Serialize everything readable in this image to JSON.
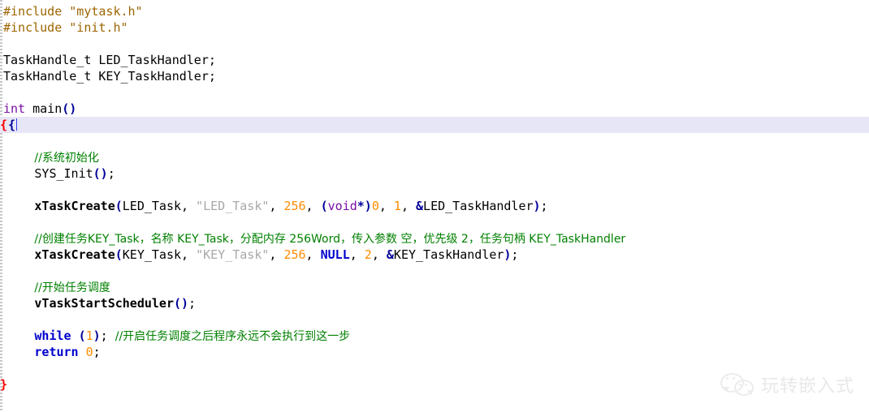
{
  "window": {
    "kind": "source-code-editor",
    "language": "C",
    "background": "#ffffff"
  },
  "colors": {
    "preprocessor": "#9c6500",
    "string": "#a8a8a8",
    "keyword_violet": "#7a0ea6",
    "keyword_bold_blue": "#0000cd",
    "punctuation": "#00009a",
    "number": "#ff8c00",
    "comment": "#008000",
    "plain": "#000000",
    "brace_marker": "#ff0000",
    "current_line_bg": "#e6e6f7",
    "caret": "#3a3af0"
  },
  "code": {
    "lines": [
      {
        "n": 1,
        "indent": 0,
        "tokens": [
          {
            "t": "#include ",
            "c": "pre"
          },
          {
            "t": "\"mytask.h\"",
            "c": "pre"
          }
        ]
      },
      {
        "n": 2,
        "indent": 0,
        "tokens": [
          {
            "t": "#include ",
            "c": "pre"
          },
          {
            "t": "\"init.h\"",
            "c": "pre"
          }
        ]
      },
      {
        "n": 3,
        "indent": 0,
        "tokens": []
      },
      {
        "n": 4,
        "indent": 0,
        "tokens": [
          {
            "t": "TaskHandle_t LED_TaskHandler;",
            "c": "plain"
          }
        ]
      },
      {
        "n": 5,
        "indent": 0,
        "tokens": [
          {
            "t": "TaskHandle_t KEY_TaskHandler;",
            "c": "plain"
          }
        ]
      },
      {
        "n": 6,
        "indent": 0,
        "tokens": []
      },
      {
        "n": 7,
        "indent": 0,
        "tokens": [
          {
            "t": "int",
            "c": "kw"
          },
          {
            "t": " main",
            "c": "plain"
          },
          {
            "t": "()",
            "c": "punct"
          }
        ]
      },
      {
        "n": 8,
        "indent": 0,
        "current": true,
        "marker": "{",
        "caret": true,
        "tokens": [
          {
            "t": "{",
            "c": "punct"
          }
        ]
      },
      {
        "n": 9,
        "indent": 0,
        "tokens": []
      },
      {
        "n": 10,
        "indent": 4,
        "tokens": [
          {
            "t": "//系统初始化",
            "c": "cmt"
          }
        ]
      },
      {
        "n": 11,
        "indent": 4,
        "tokens": [
          {
            "t": "SYS_Init",
            "c": "plain"
          },
          {
            "t": "()",
            "c": "punct"
          },
          {
            "t": ";",
            "c": "plain"
          }
        ]
      },
      {
        "n": 12,
        "indent": 0,
        "tokens": []
      },
      {
        "n": 13,
        "indent": 4,
        "tokens": [
          {
            "t": "xTaskCreate",
            "c": "bold"
          },
          {
            "t": "(",
            "c": "punct"
          },
          {
            "t": "LED_Task, ",
            "c": "plain"
          },
          {
            "t": "\"LED_Task\"",
            "c": "str"
          },
          {
            "t": ", ",
            "c": "plain"
          },
          {
            "t": "256",
            "c": "num"
          },
          {
            "t": ", ",
            "c": "plain"
          },
          {
            "t": "(",
            "c": "punct"
          },
          {
            "t": "void",
            "c": "kw"
          },
          {
            "t": "*)",
            "c": "punct"
          },
          {
            "t": "0",
            "c": "num"
          },
          {
            "t": ", ",
            "c": "plain"
          },
          {
            "t": "1",
            "c": "num"
          },
          {
            "t": ", ",
            "c": "plain"
          },
          {
            "t": "&",
            "c": "punct"
          },
          {
            "t": "LED_TaskHandler",
            "c": "plain"
          },
          {
            "t": ")",
            "c": "punct"
          },
          {
            "t": ";",
            "c": "plain"
          }
        ]
      },
      {
        "n": 14,
        "indent": 0,
        "tokens": []
      },
      {
        "n": 15,
        "indent": 4,
        "tokens": [
          {
            "t": "//创建任务KEY_Task，名称 KEY_Task，分配内存 256Word，传入参数 空，优先级 2，任务句柄 KEY_TaskHandler",
            "c": "cmt"
          }
        ]
      },
      {
        "n": 16,
        "indent": 4,
        "tokens": [
          {
            "t": "xTaskCreate",
            "c": "bold"
          },
          {
            "t": "(",
            "c": "punct"
          },
          {
            "t": "KEY_Task, ",
            "c": "plain"
          },
          {
            "t": "\"KEY_Task\"",
            "c": "str"
          },
          {
            "t": ", ",
            "c": "plain"
          },
          {
            "t": "256",
            "c": "num"
          },
          {
            "t": ", ",
            "c": "plain"
          },
          {
            "t": "NULL",
            "c": "kwb"
          },
          {
            "t": ", ",
            "c": "plain"
          },
          {
            "t": "2",
            "c": "num"
          },
          {
            "t": ", ",
            "c": "plain"
          },
          {
            "t": "&",
            "c": "punct"
          },
          {
            "t": "KEY_TaskHandler",
            "c": "plain"
          },
          {
            "t": ")",
            "c": "punct"
          },
          {
            "t": ";",
            "c": "plain"
          }
        ]
      },
      {
        "n": 17,
        "indent": 0,
        "tokens": []
      },
      {
        "n": 18,
        "indent": 4,
        "tokens": [
          {
            "t": "//开始任务调度",
            "c": "cmt"
          }
        ]
      },
      {
        "n": 19,
        "indent": 4,
        "tokens": [
          {
            "t": "vTaskStartScheduler",
            "c": "bold"
          },
          {
            "t": "()",
            "c": "punct"
          },
          {
            "t": ";",
            "c": "plain"
          }
        ]
      },
      {
        "n": 20,
        "indent": 0,
        "tokens": []
      },
      {
        "n": 21,
        "indent": 4,
        "tokens": [
          {
            "t": "while",
            "c": "kwb"
          },
          {
            "t": " ",
            "c": "plain"
          },
          {
            "t": "(",
            "c": "punct"
          },
          {
            "t": "1",
            "c": "num"
          },
          {
            "t": ")",
            "c": "punct"
          },
          {
            "t": "; ",
            "c": "plain"
          },
          {
            "t": "//开启任务调度之后程序永远不会执行到这一步",
            "c": "cmt"
          }
        ]
      },
      {
        "n": 22,
        "indent": 4,
        "tokens": [
          {
            "t": "return",
            "c": "kwb"
          },
          {
            "t": " ",
            "c": "plain"
          },
          {
            "t": "0",
            "c": "num"
          },
          {
            "t": ";",
            "c": "plain"
          }
        ]
      },
      {
        "n": 23,
        "indent": 0,
        "tokens": []
      },
      {
        "n": 24,
        "indent": 0,
        "marker_close": "}",
        "tokens": []
      },
      {
        "n": 25,
        "indent": 0,
        "tokens": []
      }
    ]
  },
  "watermark": {
    "logo_name": "wechat-logo-icon",
    "text": "玩转嵌入式"
  }
}
